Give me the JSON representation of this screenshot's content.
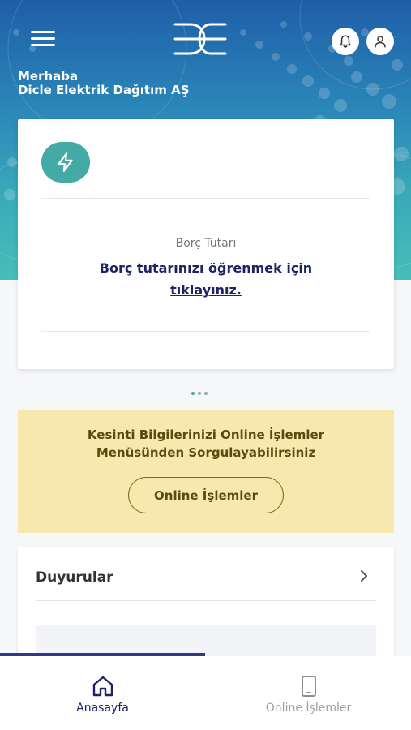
{
  "header": {
    "menu_icon": "hamburger-icon",
    "logo_icon": "dicle-logo-icon",
    "notification_icon": "bell-icon",
    "profile_icon": "user-icon",
    "greeting": "Merhaba",
    "company_name": "Dicle Elektrik Dağıtım AŞ"
  },
  "debt_card": {
    "icon": "lightning-icon",
    "label": "Borç Tutarı",
    "link_text_line1": "Borç tutarınızı öğrenmek için",
    "link_text_line2": "tıklayınız.",
    "active_page": 2,
    "page_count": 3
  },
  "notice": {
    "text_part1": "Kesinti Bilgilerinizi ",
    "text_link": "Online İşlemler",
    "text_part2": "Menüsünden Sorgulayabilirsiniz",
    "button_label": "Online İşlemler"
  },
  "announcements": {
    "title": "Duyurular",
    "chevron_icon": "chevron-right-icon"
  },
  "tabbar": {
    "tabs": [
      {
        "label": "Anasayfa",
        "icon": "home-icon",
        "active": true
      },
      {
        "label": "Online İşlemler",
        "icon": "tablet-icon",
        "active": false
      }
    ]
  },
  "colors": {
    "primary_dark": "#1c2463",
    "teal": "#44aaa6",
    "notice_bg": "#f7e9ae",
    "notice_text": "#5a4a0d"
  }
}
